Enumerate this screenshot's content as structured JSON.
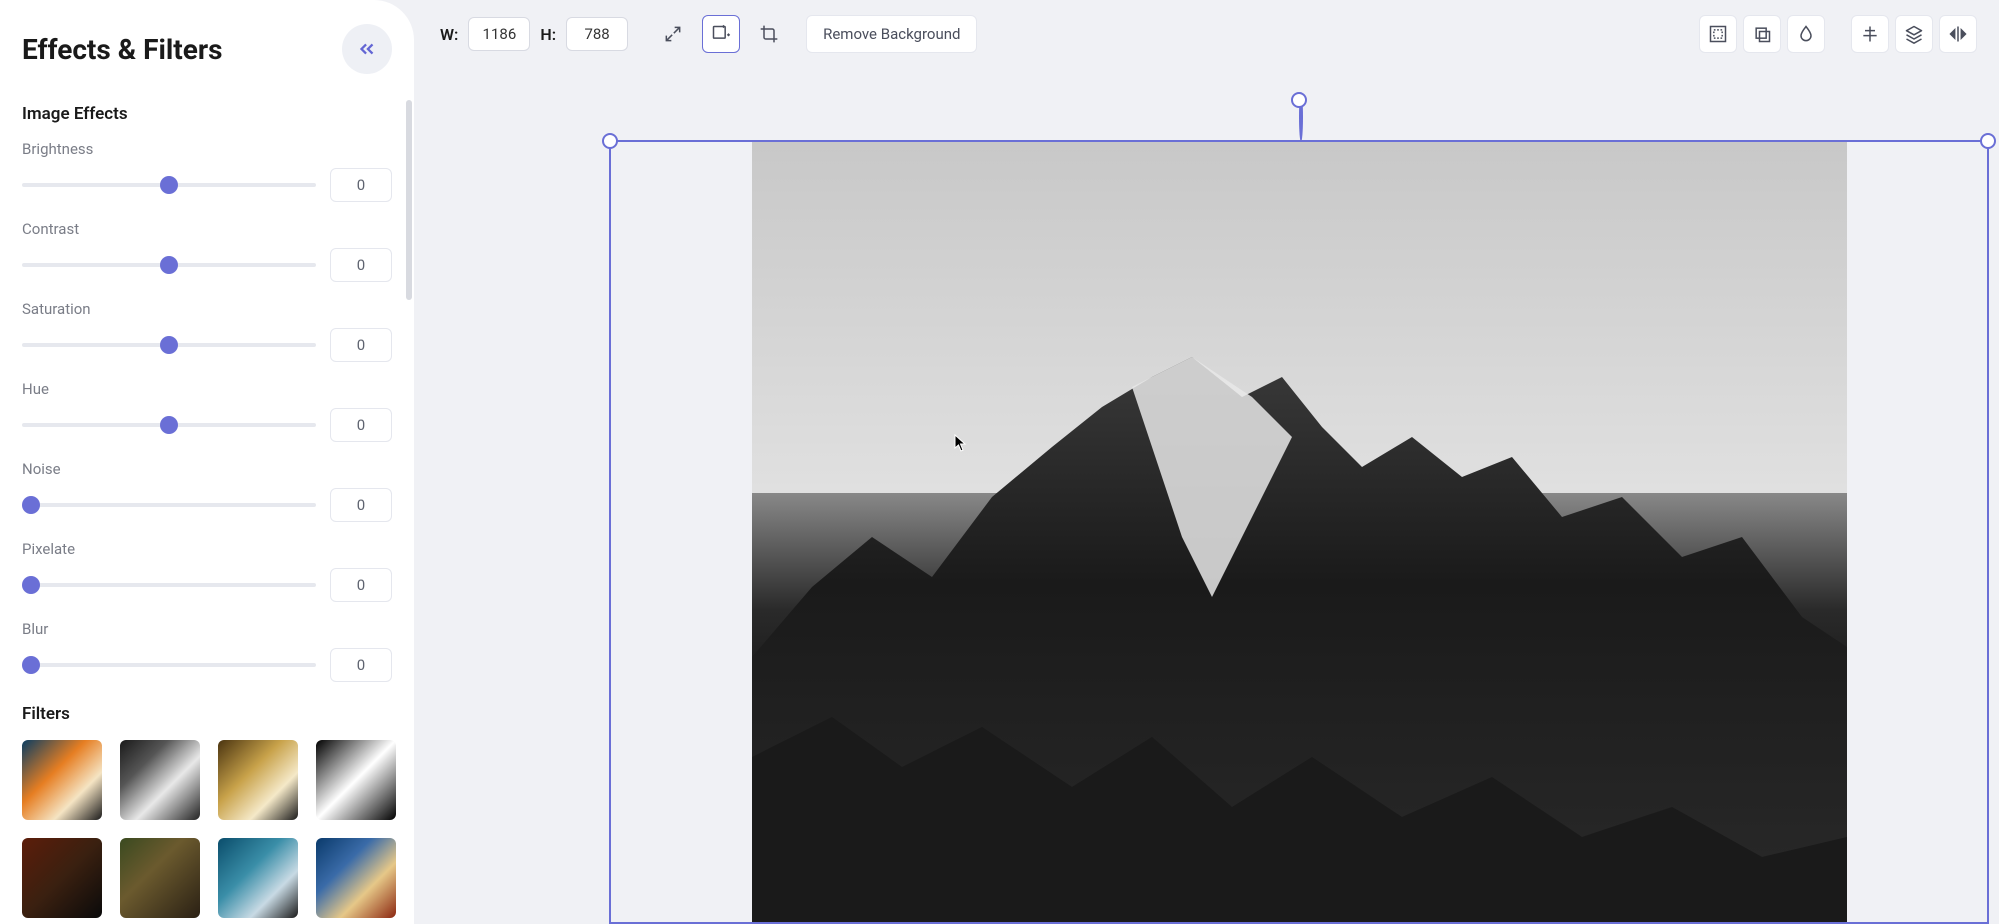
{
  "sidebar": {
    "title": "Effects & Filters",
    "section_effects": "Image Effects",
    "section_filters": "Filters",
    "effects": [
      {
        "label": "Brightness",
        "value": "0",
        "pos": 50
      },
      {
        "label": "Contrast",
        "value": "0",
        "pos": 50
      },
      {
        "label": "Saturation",
        "value": "0",
        "pos": 50
      },
      {
        "label": "Hue",
        "value": "0",
        "pos": 50
      },
      {
        "label": "Noise",
        "value": "0",
        "pos": 3
      },
      {
        "label": "Pixelate",
        "value": "0",
        "pos": 3
      },
      {
        "label": "Blur",
        "value": "0",
        "pos": 3
      }
    ],
    "filter_presets": [
      "f1",
      "f2",
      "f3",
      "f4",
      "f5",
      "f6",
      "f7",
      "f8"
    ]
  },
  "toolbar": {
    "w_label": "W:",
    "h_label": "H:",
    "w_value": "1186",
    "h_value": "788",
    "remove_bg": "Remove Background"
  }
}
